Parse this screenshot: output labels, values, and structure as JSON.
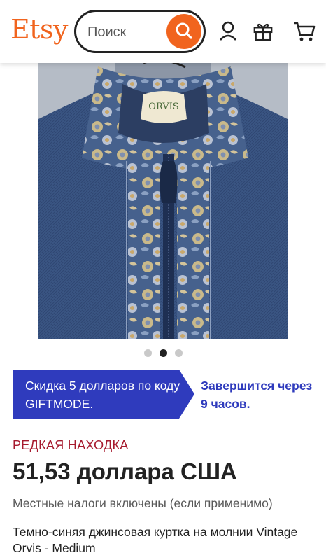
{
  "header": {
    "logo": "Etsy",
    "search_placeholder": "Поиск",
    "icons": [
      "search-icon",
      "account-icon",
      "gift-icon",
      "cart-icon"
    ]
  },
  "gallery": {
    "image_label": "ORVIS",
    "dots_count": 3,
    "active_dot": 2
  },
  "promo": {
    "text": "Скидка 5 долларов по коду GIFTMODE.",
    "expires": "Завершится через 9 часов.",
    "color": "#2f3bbd"
  },
  "listing": {
    "badge": "РЕДКАЯ НАХОДКА",
    "price": "51,53 доллара США",
    "taxes": "Местные налоги включены (если применимо)",
    "title": "Темно-синяя джинсовая куртка на молнии Vintage Orvis - Medium"
  },
  "colors": {
    "brand": "#f1641e",
    "promo_blue": "#2f3bbd",
    "rare_red": "#a61a2e"
  }
}
